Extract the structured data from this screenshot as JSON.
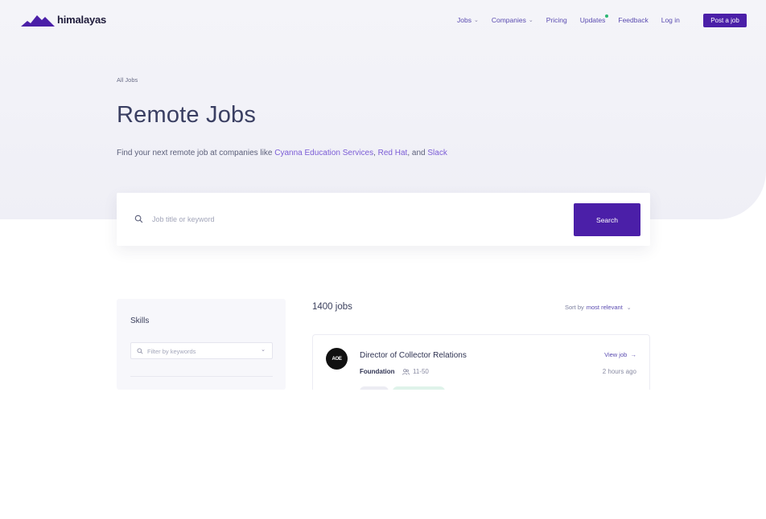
{
  "brand": {
    "name": "himalayas",
    "logo_icon": "mountain-logo-icon",
    "accent": "#4b1fa8"
  },
  "nav": {
    "items": [
      {
        "label": "Jobs",
        "has_dropdown": true
      },
      {
        "label": "Companies",
        "has_dropdown": true
      },
      {
        "label": "Pricing",
        "has_dropdown": false
      },
      {
        "label": "Updates",
        "has_dropdown": false,
        "has_dot": true
      },
      {
        "label": "Feedback",
        "has_dropdown": false
      },
      {
        "label": "Log in",
        "has_dropdown": false
      }
    ],
    "post_job": "Post a job"
  },
  "hero": {
    "breadcrumb": "All Jobs",
    "title": "Remote Jobs",
    "subtitle_prefix": "Find your next remote job at companies like ",
    "company_1": "Cyanna Education Services",
    "sep_1": ", ",
    "company_2": "Red Hat",
    "sep_2": ", and ",
    "company_3": "Slack"
  },
  "search": {
    "placeholder": "Job title or keyword",
    "value": "",
    "button": "Search"
  },
  "sidebar": {
    "section_title": "Skills",
    "filter_placeholder": "Filter by keywords"
  },
  "results": {
    "count_label": "1400 jobs",
    "sort_prefix": "Sort by",
    "sort_value": "most relevant"
  },
  "jobs": [
    {
      "logo_text": "AOE",
      "title": "Director of Collector Relations",
      "company": "Foundation",
      "size": "11-50",
      "view_label": "View job",
      "posted": "2 hours ago"
    }
  ]
}
